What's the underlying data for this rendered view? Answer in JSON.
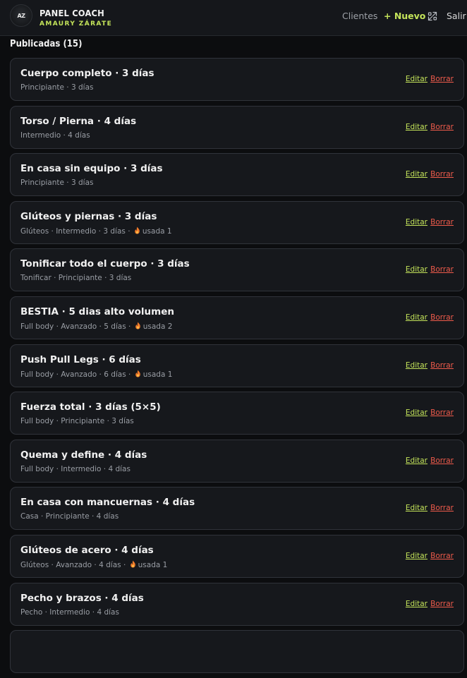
{
  "header": {
    "logo_text": "AZ",
    "title": "PANEL COACH",
    "subtitle": "AMAURY ZÁRATE",
    "nav": {
      "clients": "Clientes",
      "new": "+ Nuevo",
      "swap_icon": "arrows-swap-icon",
      "logout": "Salir"
    }
  },
  "section": {
    "title": "Publicadas (15)"
  },
  "actions": {
    "edit": "Editar",
    "delete": "Borrar"
  },
  "colors": {
    "accent": "#c4e45a",
    "danger": "#ef5b4b",
    "background": "#0c0d0f",
    "card": "#16181c"
  },
  "routines": [
    {
      "title": "Cuerpo completo · 3 días",
      "meta": "Principiante · 3 días",
      "usage": ""
    },
    {
      "title": "Torso / Pierna · 4 días",
      "meta": "Intermedio · 4 días",
      "usage": ""
    },
    {
      "title": "En casa sin equipo · 3 días",
      "meta": "Principiante · 3 días",
      "usage": ""
    },
    {
      "title": "Glúteos y piernas · 3 días",
      "meta": "Glúteos · Intermedio · 3 días ·",
      "usage": "usada 1"
    },
    {
      "title": "Tonificar todo el cuerpo · 3 días",
      "meta": "Tonificar · Principiante · 3 días",
      "usage": ""
    },
    {
      "title": "BESTIA · 5 dias alto volumen",
      "meta": "Full body · Avanzado · 5 días ·",
      "usage": "usada 2"
    },
    {
      "title": "Push Pull Legs · 6 días",
      "meta": "Full body · Avanzado · 6 días ·",
      "usage": "usada 1"
    },
    {
      "title": "Fuerza total · 3 días (5×5)",
      "meta": "Full body · Principiante · 3 días",
      "usage": ""
    },
    {
      "title": "Quema y define · 4 días",
      "meta": "Full body · Intermedio · 4 días",
      "usage": ""
    },
    {
      "title": "En casa con mancuernas · 4 días",
      "meta": "Casa · Principiante · 4 días",
      "usage": ""
    },
    {
      "title": "Glúteos de acero · 4 días",
      "meta": "Glúteos · Avanzado · 4 días ·",
      "usage": "usada 1"
    },
    {
      "title": "Pecho y brazos · 4 días",
      "meta": "Pecho · Intermedio · 4 días",
      "usage": ""
    }
  ]
}
